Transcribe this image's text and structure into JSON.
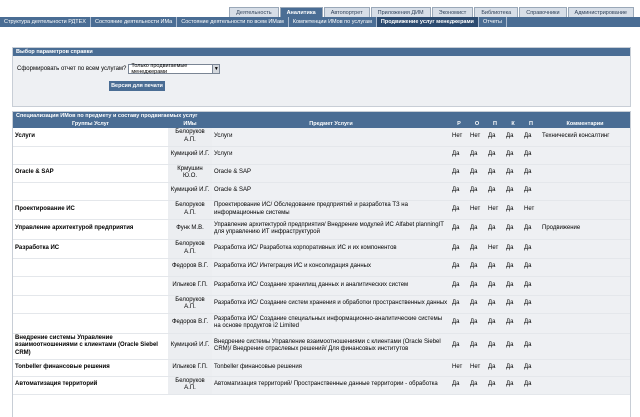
{
  "main_tabs": [
    "Деятельность",
    "Аналитика",
    "Автопортрет",
    "Приложения ДИМ",
    "Экономист",
    "Библиотека",
    "Справочники",
    "Администрирование"
  ],
  "main_tab_active": 1,
  "sub_tabs": [
    "Структура деятельности РДТЕХ",
    "Состояние деятельности ИМа",
    "Состояние деятельности по всем ИМам",
    "Компетенции ИМов по услугам",
    "Продвижение услуг менеджерами",
    "Отчеты"
  ],
  "sub_tab_active": 4,
  "params": {
    "title": "Выбор параметров справки",
    "label": "Сформировать отчет по всем услугам?",
    "select_value": "Только продвигаемые менеджерами",
    "print_button": "Версия для печати"
  },
  "spec": {
    "title": "Специализация ИМов по предмету и составу продвигаемых услуг",
    "headers": [
      "Группы Услуг",
      "ИМы",
      "Предмет Услуги",
      "Р",
      "О",
      "П",
      "К",
      "П",
      "Комментарии"
    ],
    "rows": [
      {
        "group": "Услуги",
        "im": "Белоруков А.П.",
        "subject": "Услуги",
        "r": "Нет",
        "o": "Нет",
        "p": "Да",
        "k": "Да",
        "p2": "Да",
        "comment": "Технический консалтинг"
      },
      {
        "group": "",
        "im": "Кумицкий И.Г.",
        "subject": "Услуги",
        "r": "Да",
        "o": "Да",
        "p": "Да",
        "k": "Да",
        "p2": "Да",
        "comment": ""
      },
      {
        "group": "Oracle & SAP",
        "im": "Крмушин Ю.О.",
        "subject": "Oracle & SAP",
        "r": "Да",
        "o": "Да",
        "p": "Да",
        "k": "Да",
        "p2": "Да",
        "comment": ""
      },
      {
        "group": "",
        "im": "Кумицкий И.Г.",
        "subject": "Oracle & SAP",
        "r": "Да",
        "o": "Да",
        "p": "Да",
        "k": "Да",
        "p2": "Да",
        "comment": ""
      },
      {
        "group": "Проектирование ИС",
        "im": "Белоруков А.П.",
        "subject": "Проектирование ИС/ Обследование предприятий и разработка ТЗ на информационные системы",
        "r": "Да",
        "o": "Нет",
        "p": "Нет",
        "k": "Да",
        "p2": "Нет",
        "comment": ""
      },
      {
        "group": "Управление архитектурой предприятия",
        "im": "Функ М.В.",
        "subject": "Управление архитектурой предприятия/ Внедрение модулей ИС Alfabet planningIT для управлению ИТ инфраструктурой",
        "r": "Да",
        "o": "Да",
        "p": "Да",
        "k": "Да",
        "p2": "Да",
        "comment": "Продвижение"
      },
      {
        "group": "Разработка ИС",
        "im": "Белоруков А.П.",
        "subject": "Разработка ИС/ Разработка корпоративных ИС и их компонентов",
        "r": "Да",
        "o": "Да",
        "p": "Нет",
        "k": "Да",
        "p2": "Да",
        "comment": ""
      },
      {
        "group": "",
        "im": "Федоров В.Г.",
        "subject": "Разработка ИС/ Интеграция ИС и консолидация данных",
        "r": "Да",
        "o": "Да",
        "p": "Да",
        "k": "Да",
        "p2": "Да",
        "comment": ""
      },
      {
        "group": "",
        "im": "Ильиков Г.П.",
        "subject": "Разработка ИС/ Создание хранилищ данных и аналитических систем",
        "r": "Да",
        "o": "Да",
        "p": "Да",
        "k": "Да",
        "p2": "Да",
        "comment": ""
      },
      {
        "group": "",
        "im": "Белоруков А.П.",
        "subject": "Разработка ИС/ Создание систем хранения и обработки пространственных данных",
        "r": "Да",
        "o": "Да",
        "p": "Да",
        "k": "Да",
        "p2": "Да",
        "comment": ""
      },
      {
        "group": "",
        "im": "Федоров В.Г.",
        "subject": "Разработка ИС/ Создание специальных информационно-аналитические системы на основе продуктов i2 Limited",
        "r": "Да",
        "o": "Да",
        "p": "Да",
        "k": "Да",
        "p2": "Да",
        "comment": ""
      },
      {
        "group": "Внедрение системы Управление взаимоотношениями с клиентами (Oracle Siebel CRM)",
        "im": "Кумицкий И.Г.",
        "subject": "Внедрение системы Управление взаимоотношениями с клиентами (Oracle Siebel CRM)/ Внедрение отраслевых решений/ Для финансовых институтов",
        "r": "Да",
        "o": "Да",
        "p": "Да",
        "k": "Да",
        "p2": "Да",
        "comment": ""
      },
      {
        "group": "Tonbeller финансовые решения",
        "im": "Ильиков Г.П.",
        "subject": "Tonbeller финансовые решения",
        "r": "Нет",
        "o": "Нет",
        "p": "Да",
        "k": "Да",
        "p2": "Да",
        "comment": ""
      },
      {
        "group": "Автоматизация территорий",
        "im": "Белоруков А.П.",
        "subject": "Автоматизация территорий/ Пространственные данные территории - обработка",
        "r": "Да",
        "o": "Да",
        "p": "Да",
        "k": "Да",
        "p2": "Да",
        "comment": ""
      }
    ]
  }
}
